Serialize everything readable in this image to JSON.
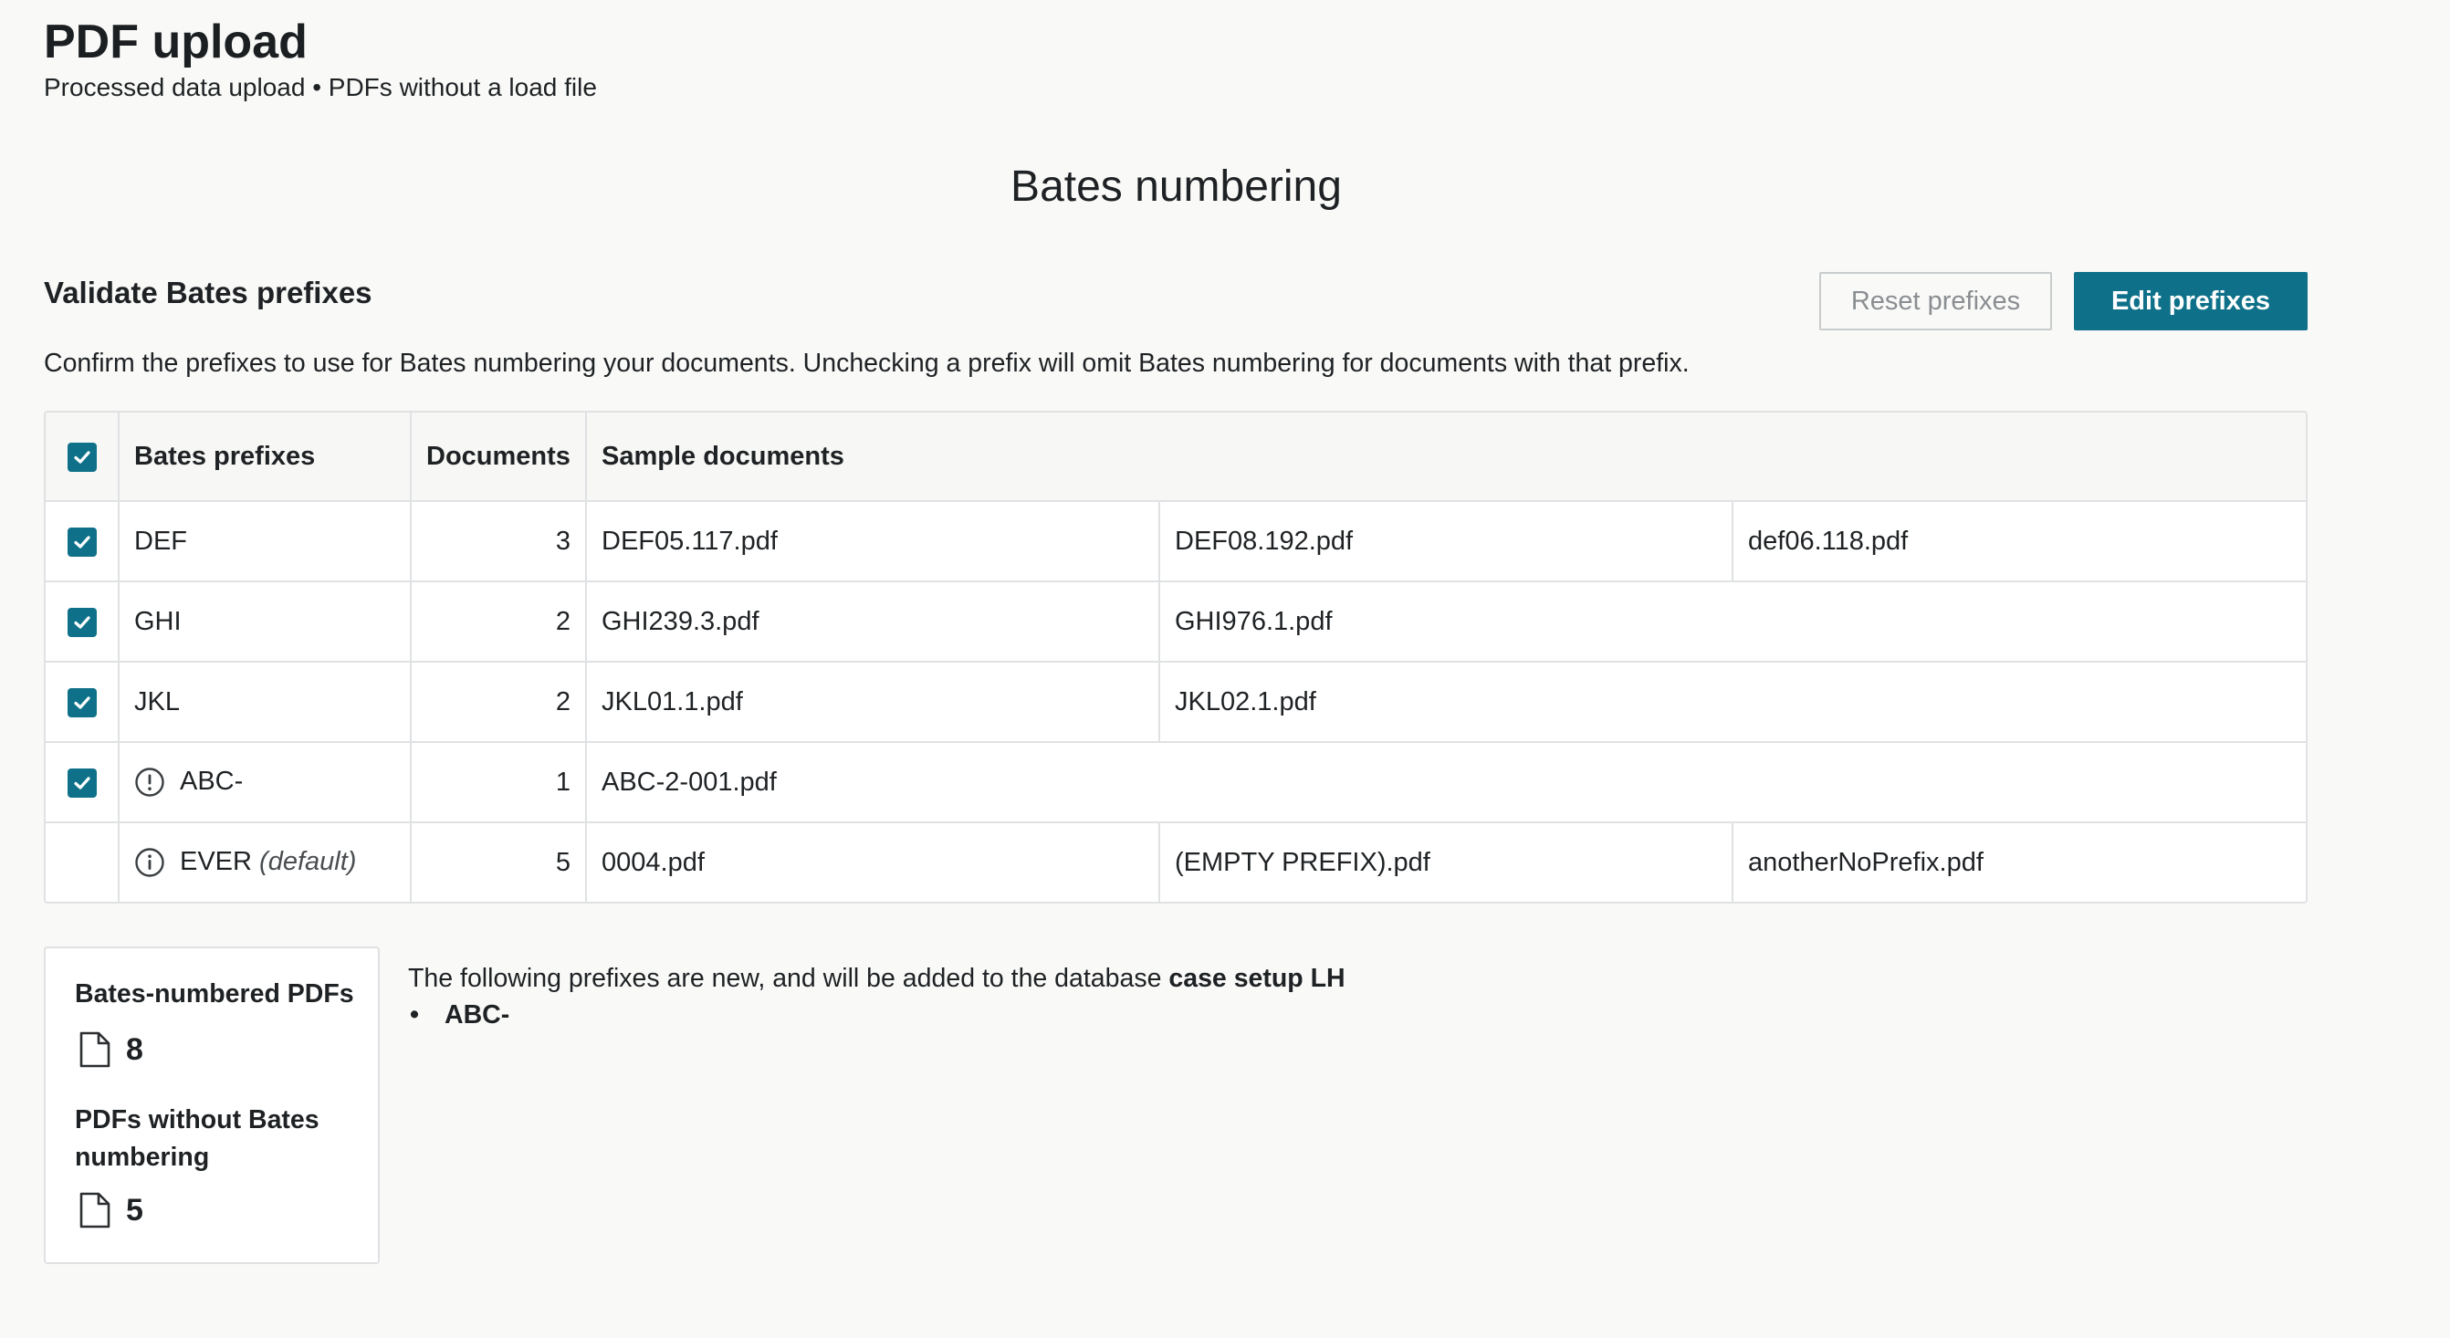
{
  "page": {
    "title": "PDF upload",
    "subtitle": "Processed data upload • PDFs without a load file"
  },
  "section": {
    "heading": "Bates numbering",
    "subheading": "Validate Bates prefixes",
    "description": "Confirm the prefixes to use for Bates numbering your documents. Unchecking a prefix will omit Bates numbering for documents with that prefix."
  },
  "buttons": {
    "reset_label": "Reset prefixes",
    "edit_label": "Edit prefixes"
  },
  "table": {
    "headers": {
      "prefix": "Bates prefixes",
      "documents": "Documents",
      "samples": "Sample documents"
    },
    "select_all_checked": true,
    "rows": [
      {
        "checked": true,
        "prefix": "DEF",
        "default_tag": "",
        "documents": "3",
        "samples": [
          "DEF05.117.pdf",
          "DEF08.192.pdf",
          "def06.118.pdf"
        ]
      },
      {
        "checked": true,
        "prefix": "GHI",
        "default_tag": "",
        "documents": "2",
        "samples": [
          "GHI239.3.pdf",
          "GHI976.1.pdf",
          ""
        ]
      },
      {
        "checked": true,
        "prefix": "JKL",
        "default_tag": "",
        "documents": "2",
        "samples": [
          "JKL01.1.pdf",
          "JKL02.1.pdf",
          ""
        ]
      },
      {
        "checked": true,
        "icon": "alert-circle-icon",
        "prefix": "ABC-",
        "default_tag": "",
        "documents": "1",
        "samples": [
          "ABC-2-001.pdf",
          "",
          ""
        ]
      },
      {
        "checked": false,
        "icon": "info-circle-icon",
        "prefix": "EVER",
        "default_tag": "(default)",
        "documents": "5",
        "samples": [
          "0004.pdf",
          "(EMPTY PREFIX).pdf",
          "anotherNoPrefix.pdf"
        ]
      }
    ]
  },
  "stats": {
    "numbered_label": "Bates-numbered PDFs",
    "numbered_value": "8",
    "unnumbered_label": "PDFs without Bates numbering",
    "unnumbered_value": "5"
  },
  "notice": {
    "text": "The following prefixes are new, and will be added to the database ",
    "database_name": "case setup LH",
    "new_prefixes": [
      "ABC-"
    ]
  },
  "colors": {
    "accent": "#0e7189",
    "border": "#dfe1e2",
    "background": "#f9f9f8"
  }
}
